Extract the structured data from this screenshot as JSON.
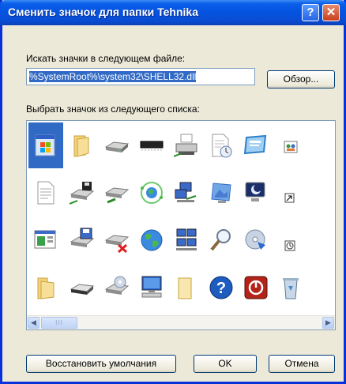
{
  "window": {
    "title": "Сменить значок для папки Tehnika",
    "help_label": "?",
    "close_label": "✕"
  },
  "file": {
    "label": "Искать значки в следующем файле:",
    "value": "%SystemRoot%\\system32\\SHELL32.dll",
    "browse_label": "Обзор..."
  },
  "icons": {
    "label": "Выбрать значок из следующего списка:",
    "items": [
      "windows-app",
      "folder",
      "hard-drive",
      "memory-chip",
      "network-printer",
      "document-clock",
      "computer-window",
      "network-group",
      "text-document",
      "floppy-drive",
      "network-drive",
      "network-globe",
      "network-computers",
      "display-properties",
      "monitor-moon",
      "shortcut-arrow",
      "program-window",
      "floppy-save",
      "drive-disconnected",
      "world-globe",
      "network-places",
      "magnifier",
      "cd-drive",
      "clock",
      "folder-open",
      "removable-drive",
      "cd-drive-user",
      "computer-monitor",
      "blank-folder",
      "help",
      "shutdown",
      "recycle-bin"
    ],
    "scroll_thumb": "III"
  },
  "buttons": {
    "restore_label": "Восстановить умолчания",
    "ok_label": "OK",
    "cancel_label": "Отмена"
  },
  "colors": {
    "title_bar": "#0a5ee8",
    "selection": "#316ac5",
    "dialog_bg": "#ece9d8"
  }
}
